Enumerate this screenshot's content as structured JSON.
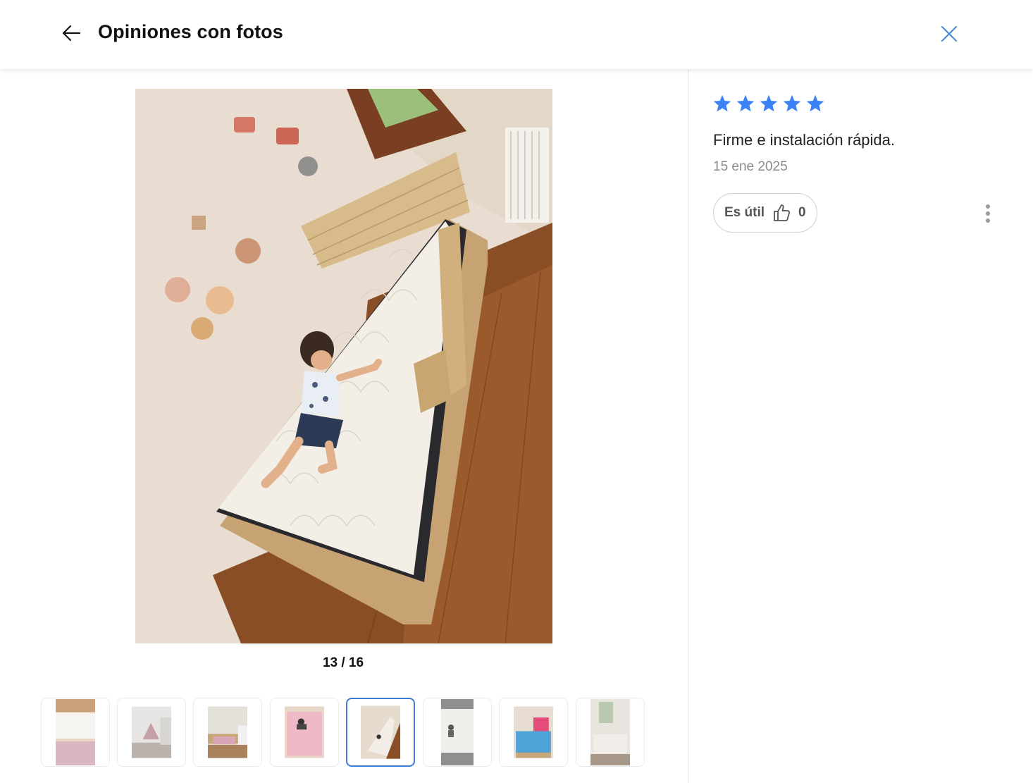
{
  "header": {
    "title": "Opiniones con fotos",
    "back_icon": "arrow-left-icon",
    "close_icon": "close-icon"
  },
  "gallery": {
    "counter": "13 / 16",
    "current_index": 13,
    "total": 16,
    "thumbnail_count": 8,
    "active_thumbnail": 5
  },
  "review": {
    "rating": 5,
    "max_rating": 5,
    "text": "Firme e instalación rápida.",
    "date": "15 ene 2025",
    "helpful_label": "Es útil",
    "helpful_count": "0",
    "more_icon": "more-vertical-icon"
  },
  "colors": {
    "accent": "#3a7bd5",
    "star": "#3b82f6"
  }
}
